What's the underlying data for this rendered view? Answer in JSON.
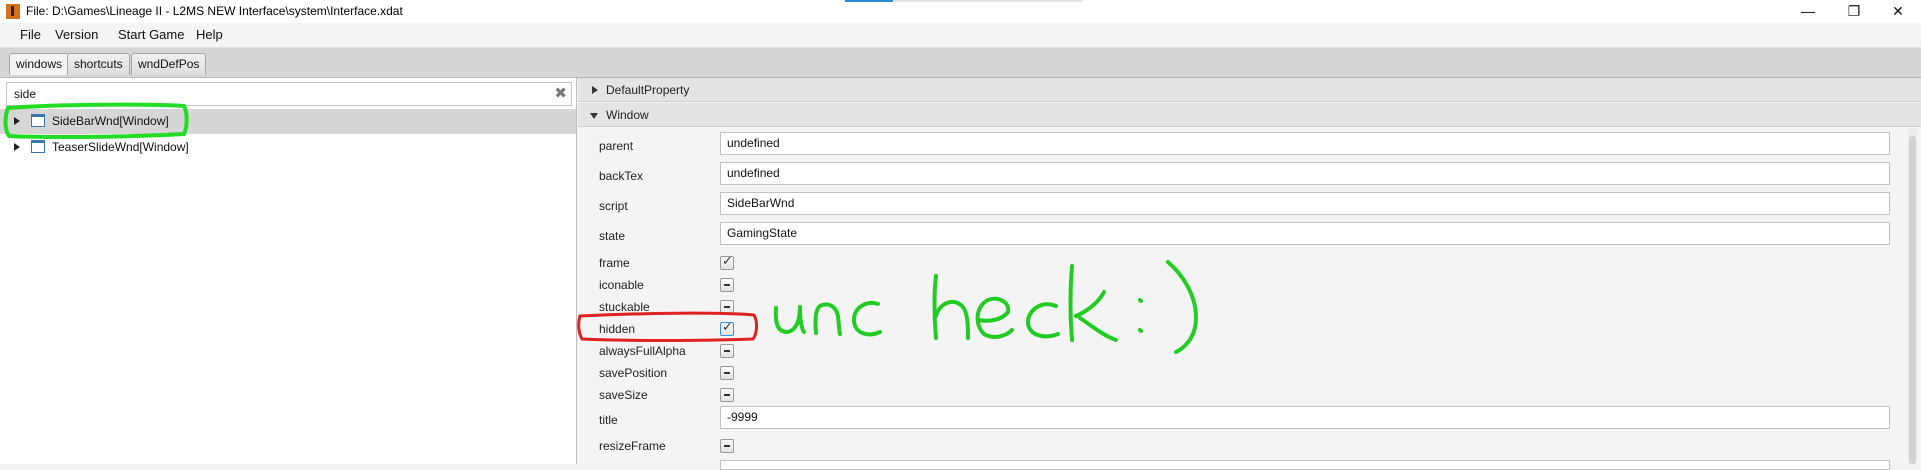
{
  "window": {
    "title": "File: D:\\Games\\Lineage II - L2MS NEW Interface\\system\\Interface.xdat",
    "minimize_glyph": "—",
    "maximize_glyph": "❐",
    "close_glyph": "✕"
  },
  "menu": [
    "File",
    "Version",
    "Start Game",
    "Help"
  ],
  "tabs": [
    "windows",
    "shortcuts",
    "wndDefPos"
  ],
  "active_tab": "windows",
  "search": {
    "value": "side",
    "clear_glyph": "✖"
  },
  "tree": [
    {
      "label": "SideBarWnd[Window]",
      "selected": true
    },
    {
      "label": "TeaserSlideWnd[Window]",
      "selected": false
    }
  ],
  "sections": {
    "default_property": "DefaultProperty",
    "window": "Window"
  },
  "properties": {
    "parent": {
      "label": "parent",
      "value": "undefined"
    },
    "backTex": {
      "label": "backTex",
      "value": "undefined"
    },
    "script": {
      "label": "script",
      "value": "SideBarWnd"
    },
    "state": {
      "label": "state",
      "value": "GamingState"
    },
    "frame": {
      "label": "frame",
      "checked": true
    },
    "iconable": {
      "label": "iconable",
      "checked": false
    },
    "stuckable": {
      "label": "stuckable",
      "checked": false
    },
    "hidden": {
      "label": "hidden",
      "checked": true
    },
    "alwaysFullAlpha": {
      "label": "alwaysFullAlpha",
      "checked": false
    },
    "savePosition": {
      "label": "savePosition",
      "checked": false
    },
    "saveSize": {
      "label": "saveSize",
      "checked": false
    },
    "title": {
      "label": "title",
      "value": "-9999"
    },
    "resizeFrame": {
      "label": "resizeFrame",
      "checked": false
    }
  },
  "annotation": {
    "text": "uncheck :)",
    "color": "#22cc22",
    "highlight_tree_color": "#22dd22",
    "highlight_hidden_color": "#dd2222"
  },
  "glyphs": {
    "check": "✓"
  }
}
